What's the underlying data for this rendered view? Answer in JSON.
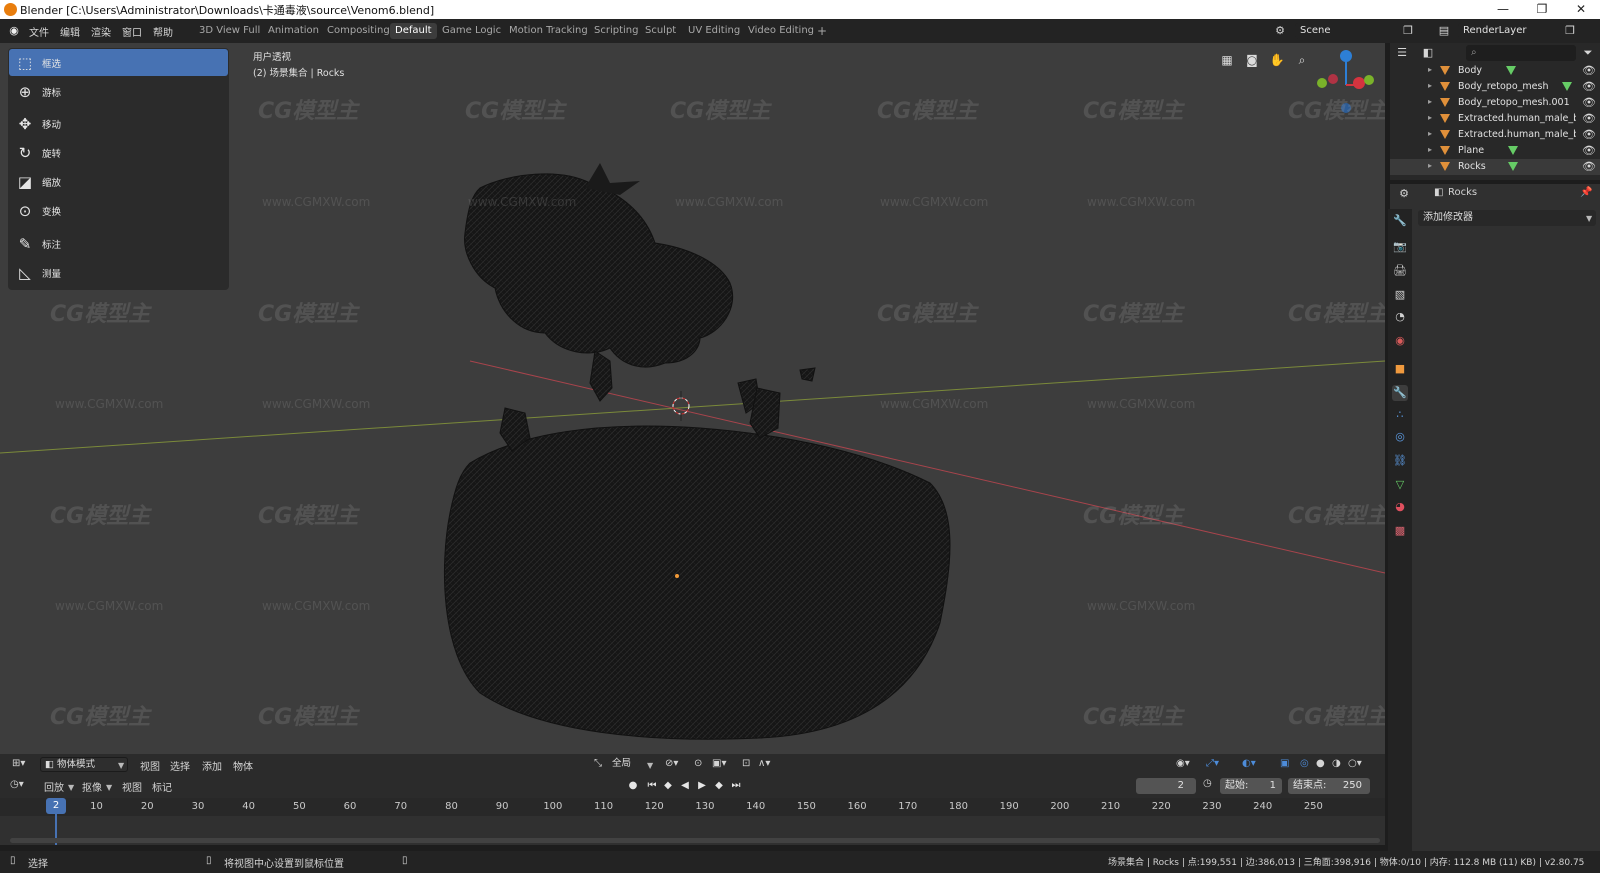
{
  "window": {
    "title": "Blender [C:\\Users\\Administrator\\Downloads\\卡通毒液\\source\\Venom6.blend]",
    "minimize": "—",
    "maximize": "❐",
    "close": "✕"
  },
  "menu": [
    "文件",
    "编辑",
    "渲染",
    "窗口",
    "帮助"
  ],
  "workspaces": [
    {
      "label": "3D View Full"
    },
    {
      "label": "Animation"
    },
    {
      "label": "Compositing"
    },
    {
      "label": "Default",
      "active": true
    },
    {
      "label": "Game Logic"
    },
    {
      "label": "Motion Tracking"
    },
    {
      "label": "Scripting"
    },
    {
      "label": "Sculpt"
    },
    {
      "label": "UV Editing"
    },
    {
      "label": "Video Editing"
    }
  ],
  "add_workspace": "+",
  "scene": {
    "label": "Scene"
  },
  "render_layer": {
    "label": "RenderLayer"
  },
  "toolbar": {
    "tools": [
      {
        "label": "框选",
        "icon": "select-box-icon",
        "active": true
      },
      {
        "label": "游标",
        "icon": "cursor-icon"
      },
      {
        "label": "移动",
        "icon": "move-icon"
      },
      {
        "label": "旋转",
        "icon": "rotate-icon"
      },
      {
        "label": "缩放",
        "icon": "scale-icon"
      },
      {
        "label": "变换",
        "icon": "transform-icon"
      },
      {
        "label": "标注",
        "icon": "annotate-icon"
      },
      {
        "label": "测量",
        "icon": "measure-icon"
      }
    ]
  },
  "viewport": {
    "view_name": "用户透视",
    "collection_info": "(2) 场景集合 | Rocks"
  },
  "watermark": {
    "brand": "CG模型主",
    "url": "www.CGMXW.com"
  },
  "viewport_header": {
    "mode": "物体模式",
    "menus": [
      "视图",
      "选择",
      "添加",
      "物体"
    ],
    "orientation": "全局"
  },
  "timeline": {
    "playback": "回放",
    "keying": "抠像",
    "view": "视图",
    "marker": "标记",
    "current_frame": "2",
    "start_label": "起始:",
    "start": "1",
    "end_label": "结束点:",
    "end": "250",
    "ticks": [
      "10",
      "20",
      "30",
      "40",
      "50",
      "60",
      "70",
      "80",
      "90",
      "100",
      "110",
      "120",
      "130",
      "140",
      "150",
      "160",
      "170",
      "180",
      "190",
      "200",
      "210",
      "220",
      "230",
      "240",
      "250"
    ],
    "playhead": "2"
  },
  "outliner": {
    "items": [
      {
        "name": "Body",
        "mesh": true
      },
      {
        "name": "Body_retopo_mesh",
        "mesh": true
      },
      {
        "name": "Body_retopo_mesh.001",
        "mesh": false
      },
      {
        "name": "Extracted.human_male_base",
        "mesh": false
      },
      {
        "name": "Extracted.human_male_base",
        "mesh": false
      },
      {
        "name": "Plane",
        "mesh": true
      },
      {
        "name": "Rocks",
        "mesh": true
      }
    ]
  },
  "properties": {
    "object_name": "Rocks",
    "add_modifier": "添加修改器"
  },
  "statusbar": {
    "left": "选择",
    "middle": "将视图中心设置到鼠标位置",
    "right": "场景集合 | Rocks | 点:199,551 | 边:386,013 | 三角面:398,916 | 物体:0/10 | 内存: 112.8 MB (11) KB) | v2.80.75"
  },
  "colors": {
    "active_blue": "#4772b3",
    "object_orange": "#e0903a",
    "mesh_green": "#66cc66"
  }
}
